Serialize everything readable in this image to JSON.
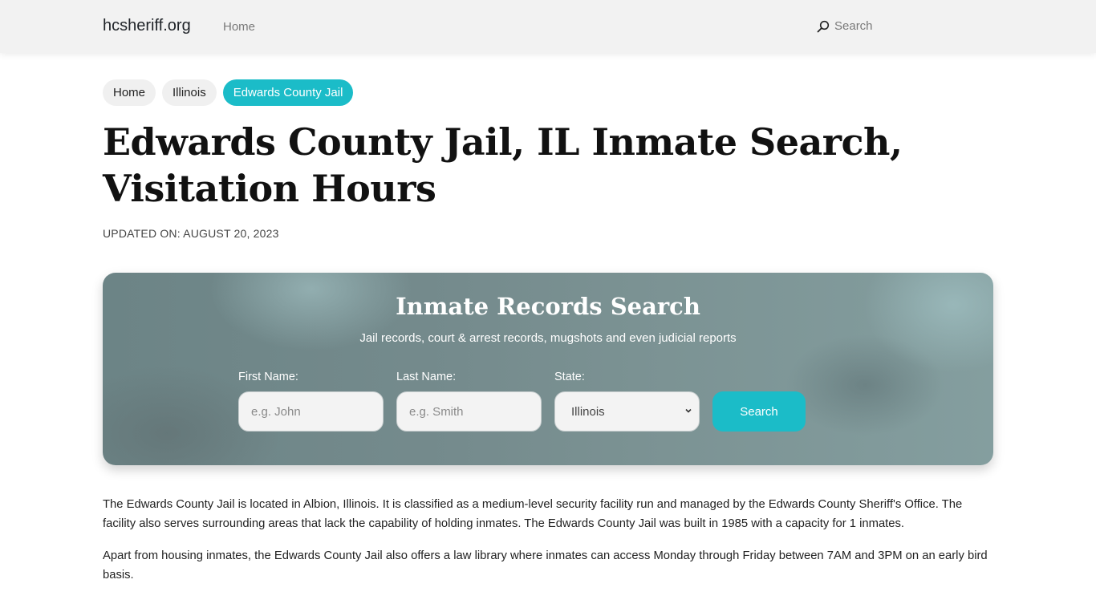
{
  "nav": {
    "brand": "hcsheriff.org",
    "home_link": "Home",
    "search_label": "Search"
  },
  "breadcrumb": [
    {
      "label": "Home"
    },
    {
      "label": "Illinois"
    },
    {
      "label": "Edwards County Jail",
      "active": true
    }
  ],
  "page": {
    "title": "Edwards County Jail, IL Inmate Search, Visitation Hours",
    "updated": "UPDATED ON: AUGUST 20, 2023"
  },
  "search_panel": {
    "title": "Inmate Records Search",
    "subtitle": "Jail records, court & arrest records, mugshots and even judicial reports",
    "first_name": {
      "label": "First Name:",
      "placeholder": "e.g. John",
      "value": ""
    },
    "last_name": {
      "label": "Last Name:",
      "placeholder": "e.g. Smith",
      "value": ""
    },
    "state": {
      "label": "State:",
      "selected": "Illinois"
    },
    "button_label": "Search"
  },
  "content": {
    "paragraphs": [
      "The Edwards County Jail is located in Albion, Illinois. It is classified as a medium-level security facility run and managed by the Edwards County Sheriff's Office. The facility also serves surrounding areas that lack the capability of holding inmates. The Edwards County Jail was built in 1985 with a capacity for 1 inmates.",
      "Apart from housing inmates, the Edwards County Jail also offers a law library where inmates can access Monday through Friday between 7AM and 3PM on an early bird basis."
    ]
  },
  "colors": {
    "accent": "#1bbcc8",
    "navbar_bg": "#f2f2f2",
    "panel_bg": "#758b8d"
  }
}
